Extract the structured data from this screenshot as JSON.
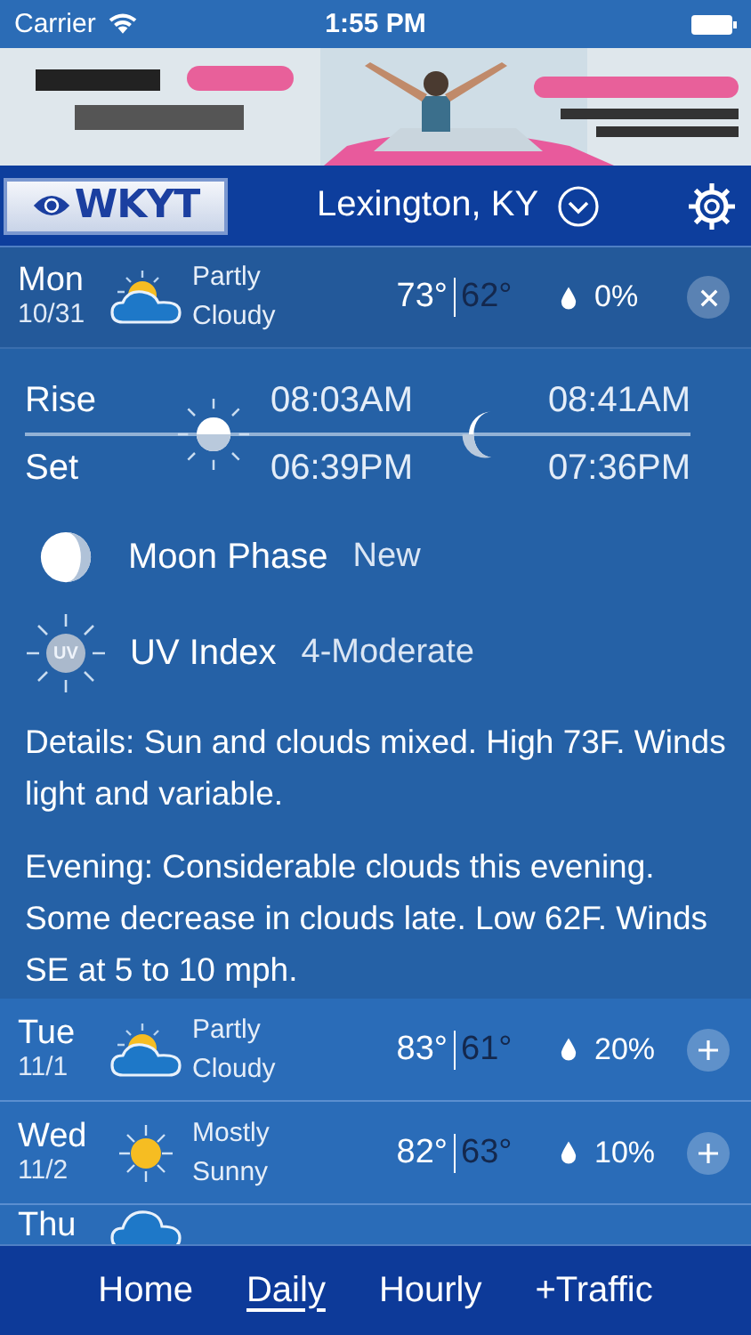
{
  "status_bar": {
    "carrier": "Carrier",
    "time": "1:55 PM"
  },
  "header": {
    "logo": "WKYT",
    "location": "Lexington, KY"
  },
  "days": [
    {
      "day": "Mon",
      "date": "10/31",
      "kind": "partly_cloudy",
      "condition": "Partly Cloudy",
      "high": "73°",
      "low": "62°",
      "precip": "0%",
      "expanded": true
    },
    {
      "day": "Tue",
      "date": "11/1",
      "kind": "partly_cloudy",
      "condition": "Partly Cloudy",
      "high": "83°",
      "low": "61°",
      "precip": "20%",
      "expanded": false
    },
    {
      "day": "Wed",
      "date": "11/2",
      "kind": "sunny",
      "condition": "Mostly Sunny",
      "high": "82°",
      "low": "63°",
      "precip": "10%",
      "expanded": false
    },
    {
      "day": "Thu",
      "kind": "cloudy",
      "expanded": false
    }
  ],
  "sun_moon": {
    "rise_label": "Rise",
    "set_label": "Set",
    "sunrise": "08:03AM",
    "sunset": "06:39PM",
    "moonrise": "08:41AM",
    "moonset": "07:36PM"
  },
  "moon_phase": {
    "label": "Moon Phase",
    "value": "New"
  },
  "uv_index": {
    "badge": "UV",
    "label": "UV Index",
    "value": "4-Moderate"
  },
  "details": [
    "Details: Sun and clouds mixed. High 73F. Winds light and variable.",
    "Evening: Considerable clouds this evening. Some decrease in clouds late. Low 62F. Winds SE at 5 to 10 mph."
  ],
  "nav": [
    {
      "label": "Home",
      "selected": false
    },
    {
      "label": "Daily",
      "selected": true
    },
    {
      "label": "Hourly",
      "selected": false
    },
    {
      "label": "+Traffic",
      "selected": false
    }
  ]
}
